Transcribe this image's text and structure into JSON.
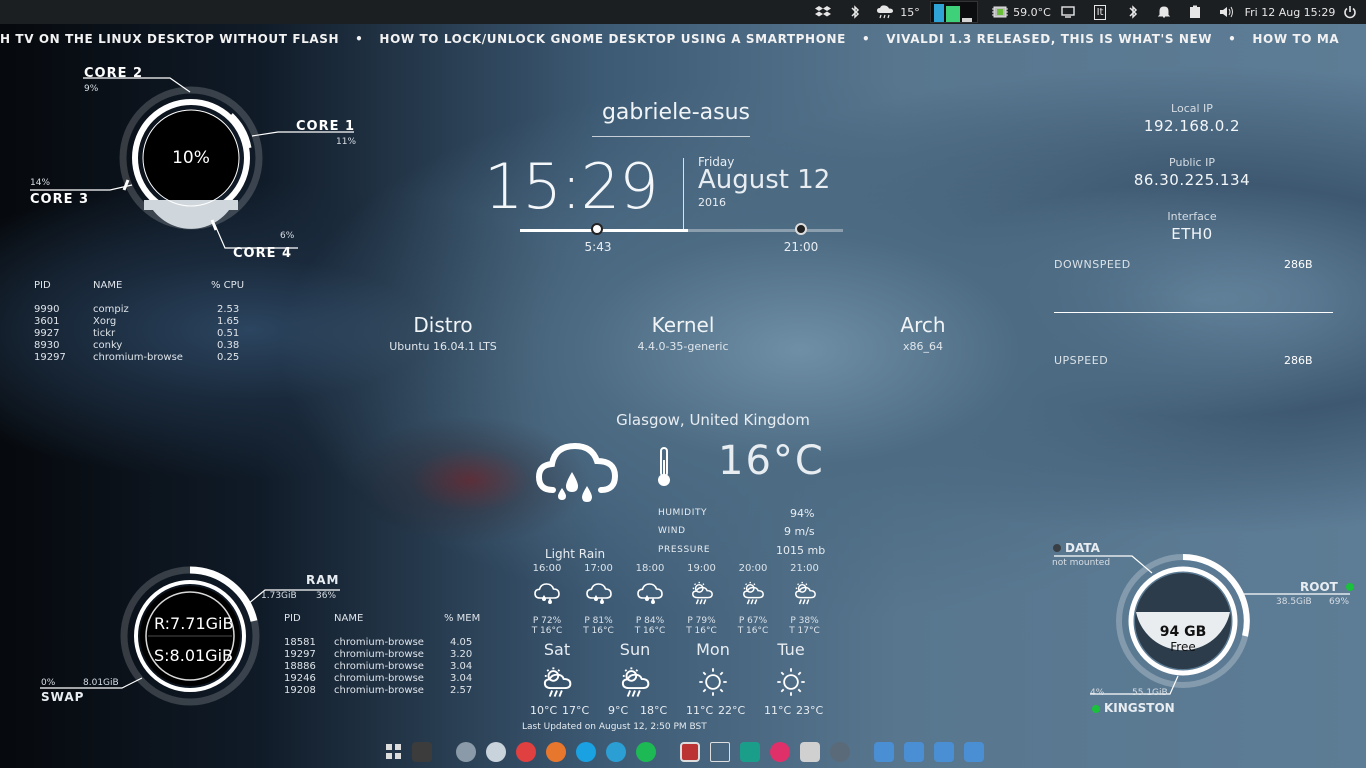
{
  "top_panel": {
    "weather_temp": "15°",
    "cpu_temp": "59.0°C",
    "datetime": "Fri 12 Aug  15:29",
    "indicator_text": "It"
  },
  "ticker": {
    "items": [
      "H TV ON THE LINUX DESKTOP WITHOUT FLASH",
      "HOW TO LOCK/UNLOCK GNOME DESKTOP USING A SMARTPHONE",
      "VIVALDI 1.3 RELEASED, THIS IS WHAT'S NEW",
      "HOW TO MA"
    ],
    "separator": "•"
  },
  "cpu": {
    "total": "10%",
    "core1": {
      "label": "CORE 1",
      "value": "11%",
      "fraction": 0.11
    },
    "core2": {
      "label": "CORE 2",
      "value": "9%",
      "fraction": 0.09
    },
    "core3": {
      "label": "CORE 3",
      "value": "14%",
      "fraction": 0.14
    },
    "core4": {
      "label": "CORE 4",
      "value": "6%",
      "fraction": 0.06
    }
  },
  "cpu_processes": {
    "headers": [
      "PID",
      "NAME",
      "% CPU"
    ],
    "rows": [
      [
        "9990",
        "compiz",
        "2.53"
      ],
      [
        "3601",
        "Xorg",
        "1.65"
      ],
      [
        "9927",
        "tickr",
        "0.51"
      ],
      [
        "8930",
        "conky",
        "0.38"
      ],
      [
        "19297",
        "chromium-browse",
        "0.25"
      ]
    ]
  },
  "host": {
    "name": "gabriele-asus",
    "time": "15:29",
    "weekday": "Friday",
    "date": "August 12",
    "year": "2016",
    "sunrise": "5:43",
    "sunset": "21:00",
    "day_progress": 0.52
  },
  "sysinfo": {
    "distro_label": "Distro",
    "distro_value": "Ubuntu 16.04.1 LTS",
    "kernel_label": "Kernel",
    "kernel_value": "4.4.0-35-generic",
    "arch_label": "Arch",
    "arch_value": "x86_64"
  },
  "network": {
    "local_ip_label": "Local IP",
    "local_ip": "192.168.0.2",
    "public_ip_label": "Public IP",
    "public_ip": "86.30.225.134",
    "interface_label": "Interface",
    "interface": "ETH0",
    "downspeed_label": "DOWNSPEED",
    "downspeed": "286B",
    "upspeed_label": "UPSPEED",
    "upspeed": "286B"
  },
  "weather": {
    "location": "Glasgow, United Kingdom",
    "temperature": "16°C",
    "condition": "Light Rain",
    "humidity_label": "HUMIDITY",
    "humidity": "94%",
    "wind_label": "WIND",
    "wind": "9 m/s",
    "pressure_label": "PRESSURE",
    "pressure": "1015 mb",
    "hourly": [
      {
        "time": "16:00",
        "p": "P  72%",
        "t": "T   16°C",
        "icon": "rain-cloud-icon"
      },
      {
        "time": "17:00",
        "p": "P   81%",
        "t": "T   16°C",
        "icon": "rain-cloud-icon"
      },
      {
        "time": "18:00",
        "p": "P  84%",
        "t": "T   16°C",
        "icon": "rain-cloud-icon"
      },
      {
        "time": "19:00",
        "p": "P  79%",
        "t": "T   16°C",
        "icon": "sun-rain-icon"
      },
      {
        "time": "20:00",
        "p": "P  67%",
        "t": "T   16°C",
        "icon": "sun-rain-icon"
      },
      {
        "time": "21:00",
        "p": "P  38%",
        "t": "T   17°C",
        "icon": "sun-rain-icon"
      }
    ],
    "daily": [
      {
        "day": "Sat",
        "low": "10°C",
        "high": "17°C",
        "icon": "sun-rain-icon"
      },
      {
        "day": "Sun",
        "low": "9°C",
        "high": "18°C",
        "icon": "sun-rain-icon"
      },
      {
        "day": "Mon",
        "low": "11°C",
        "high": "22°C",
        "icon": "sun-icon"
      },
      {
        "day": "Tue",
        "low": "11°C",
        "high": "23°C",
        "icon": "sun-icon"
      }
    ],
    "updated": "Last Updated on August 12, 2:50 PM BST"
  },
  "memory": {
    "ram_label": "RAM",
    "ram_used": "1.73GiB",
    "ram_percent": "36%",
    "ram_total": "R:7.71GiB",
    "swap_total": "S:8.01GiB",
    "swap_label": "SWAP",
    "swap_percent": "0%",
    "swap_size": "8.01GiB",
    "ram_fraction": 0.36
  },
  "mem_processes": {
    "headers": [
      "PID",
      "NAME",
      "% MEM"
    ],
    "rows": [
      [
        "18581",
        "chromium-browse",
        "4.05"
      ],
      [
        "19297",
        "chromium-browse",
        "3.20"
      ],
      [
        "18886",
        "chromium-browse",
        "3.04"
      ],
      [
        "19246",
        "chromium-browse",
        "3.04"
      ],
      [
        "19208",
        "chromium-browse",
        "2.57"
      ]
    ]
  },
  "disks": {
    "free_value": "94 GB",
    "free_label": "Free",
    "data_label": "DATA",
    "data_status": "not mounted",
    "root_label": "ROOT",
    "root_used": "38.5GiB",
    "root_percent": "69%",
    "kingston_label": "KINGSTON",
    "kingston_percent": "4%",
    "kingston_size": "55.1GiB",
    "status_ok_color": "#19c23a",
    "status_off_color": "#3a3f45"
  }
}
